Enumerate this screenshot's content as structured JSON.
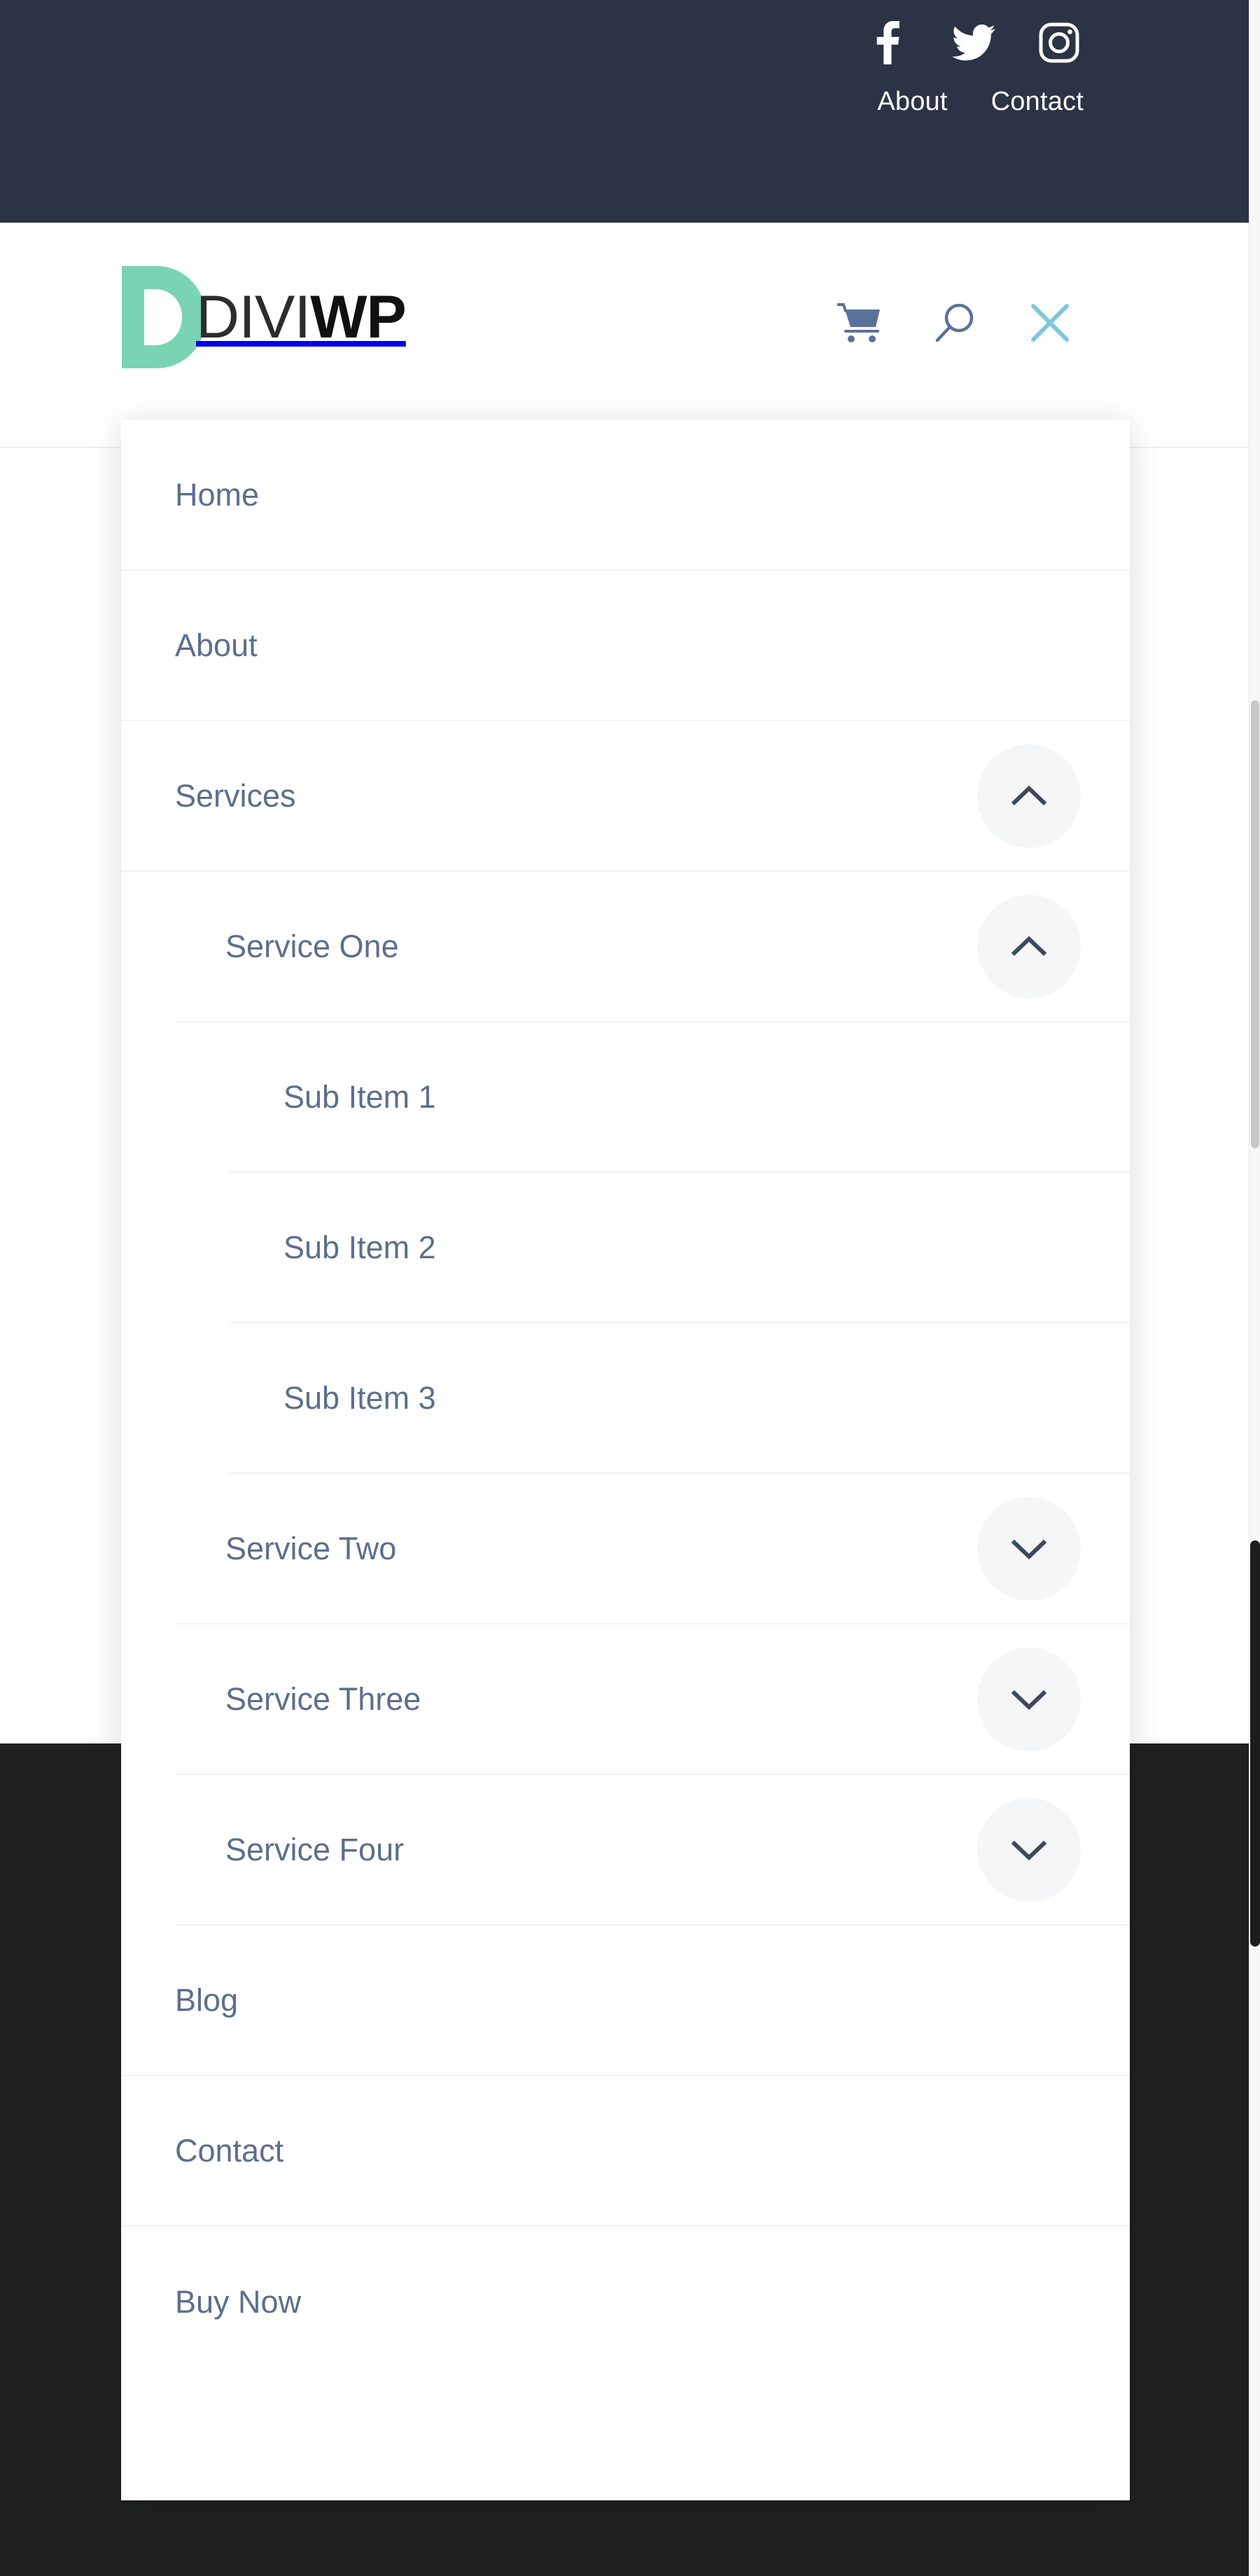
{
  "topbar": {
    "background_color": "#2b3445",
    "social": [
      {
        "name": "facebook-icon",
        "label": "Facebook"
      },
      {
        "name": "twitter-icon",
        "label": "Twitter"
      },
      {
        "name": "instagram-icon",
        "label": "Instagram"
      }
    ],
    "links": [
      {
        "label": "About"
      },
      {
        "label": "Contact"
      }
    ]
  },
  "header": {
    "logo": {
      "mark_color": "#79d4b4",
      "text_light": "DIVI",
      "text_bold": "WP",
      "alt": "DIVIWP"
    },
    "icons": [
      {
        "name": "cart-icon",
        "label": "Cart",
        "color": "#5b7199"
      },
      {
        "name": "search-icon",
        "label": "Search",
        "color": "#5b7199"
      },
      {
        "name": "close-icon",
        "label": "Close menu",
        "color": "#7fc6da"
      }
    ]
  },
  "menu": {
    "items": [
      {
        "label": "Home",
        "level": 1,
        "toggle": "none"
      },
      {
        "label": "About",
        "level": 1,
        "toggle": "none"
      },
      {
        "label": "Services",
        "level": 1,
        "toggle": "up"
      },
      {
        "label": "Service One",
        "level": 2,
        "toggle": "up"
      },
      {
        "label": "Sub Item 1",
        "level": 3,
        "toggle": "none"
      },
      {
        "label": "Sub Item 2",
        "level": 3,
        "toggle": "none"
      },
      {
        "label": "Sub Item 3",
        "level": 3,
        "toggle": "none"
      },
      {
        "label": "Service Two",
        "level": 2,
        "toggle": "down"
      },
      {
        "label": "Service Three",
        "level": 2,
        "toggle": "down"
      },
      {
        "label": "Service Four",
        "level": 2,
        "toggle": "down"
      },
      {
        "label": "Blog",
        "level": 1,
        "toggle": "none"
      },
      {
        "label": "Contact",
        "level": 1,
        "toggle": "none"
      },
      {
        "label": "Buy Now",
        "level": 1,
        "toggle": "none"
      }
    ],
    "text_color": "#5c6f8b",
    "divider_color": "#f1f2f4",
    "toggle_bg": "#f5f6f7"
  },
  "page": {
    "upper_background_color": "#ffffff",
    "lower_background_color": "#1f2022"
  }
}
